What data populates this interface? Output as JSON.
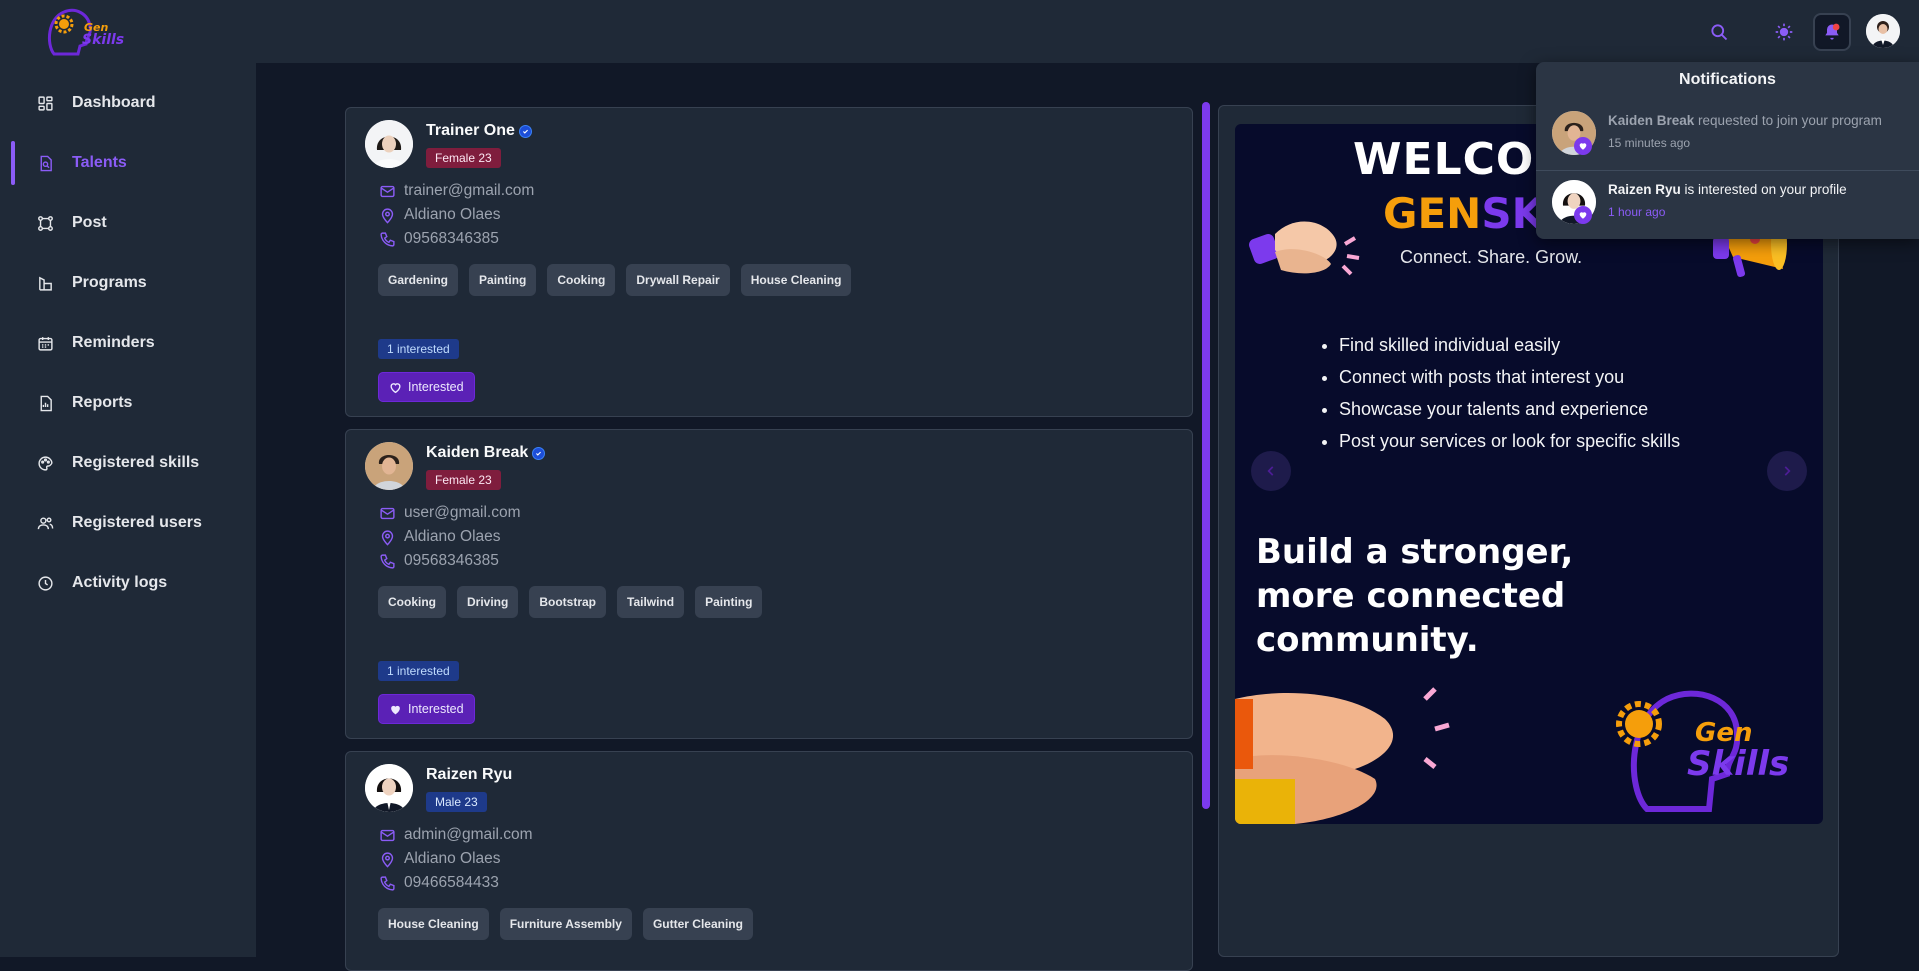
{
  "app": {
    "logo_text_top": "Gen",
    "logo_text_bottom": "Skills"
  },
  "sidebar": {
    "items": [
      {
        "label": "Dashboard",
        "icon": "dashboard-icon"
      },
      {
        "label": "Talents",
        "icon": "talents-icon",
        "active": true
      },
      {
        "label": "Post",
        "icon": "post-icon"
      },
      {
        "label": "Programs",
        "icon": "programs-icon"
      },
      {
        "label": "Reminders",
        "icon": "calendar-icon"
      },
      {
        "label": "Reports",
        "icon": "reports-icon"
      },
      {
        "label": "Registered skills",
        "icon": "palette-icon"
      },
      {
        "label": "Registered users",
        "icon": "users-icon"
      },
      {
        "label": "Activity logs",
        "icon": "clock-icon"
      }
    ]
  },
  "talents": [
    {
      "name": "Trainer One",
      "verified": true,
      "badge": "Female 23",
      "email": "trainer@gmail.com",
      "location": "Aldiano Olaes",
      "phone": "09568346385",
      "skills": [
        "Gardening",
        "Painting",
        "Cooking",
        "Drywall Repair",
        "House Cleaning"
      ],
      "interested_count": "1 interested",
      "interested_label": "Interested",
      "liked": false
    },
    {
      "name": "Kaiden Break",
      "verified": true,
      "badge": "Female 23",
      "email": "user@gmail.com",
      "location": "Aldiano Olaes",
      "phone": "09568346385",
      "skills": [
        "Cooking",
        "Driving",
        "Bootstrap",
        "Tailwind",
        "Painting"
      ],
      "interested_count": "1 interested",
      "interested_label": "Interested",
      "liked": true
    },
    {
      "name": "Raizen Ryu",
      "verified": false,
      "badge": "Male 23",
      "email": "admin@gmail.com",
      "location": "Aldiano Olaes",
      "phone": "09466584433",
      "skills": [
        "House Cleaning",
        "Furniture Assembly",
        "Gutter Cleaning"
      ]
    }
  ],
  "banner": {
    "welcome": "WELCOME TO",
    "brand_a": "GEN",
    "brand_b": "SKILLS",
    "tagline": "Connect. Share. Grow.",
    "bullets": [
      "Find skilled individual easily",
      "Connect with posts that interest you",
      "Showcase your talents and experience",
      "Post your services or look for specific skills"
    ],
    "headline": "Build a stronger, more connected community.",
    "logo_top": "Gen",
    "logo_bottom": "Skills"
  },
  "notifications": {
    "title": "Notifications",
    "items": [
      {
        "name": "Kaiden Break",
        "text": " requested to join your program",
        "time": "15 minutes ago",
        "read": true
      },
      {
        "name": "Raizen Ryu",
        "text": " is interested on your profile",
        "time": "1 hour ago",
        "read": false
      }
    ]
  },
  "colors": {
    "accent": "#8b5cf6",
    "surface": "#1f2937",
    "background": "#111827"
  }
}
